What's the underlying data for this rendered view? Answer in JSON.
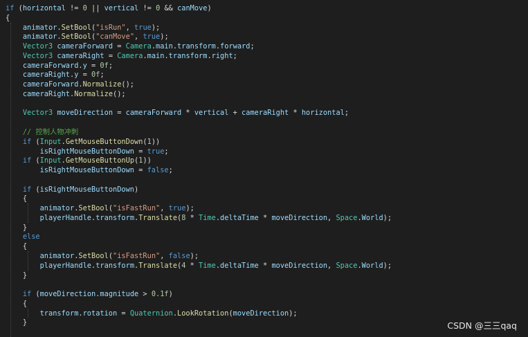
{
  "editor": {
    "colors": {
      "background": "#1e1e1e",
      "keyword": "#569cd6",
      "type": "#4ec9b0",
      "variable": "#9cdcfe",
      "method": "#dcdcaa",
      "string": "#d69d85",
      "number": "#b5cea8",
      "comment": "#57a64a",
      "plain": "#dcdcdc"
    },
    "lines": [
      {
        "indent": 0,
        "tokens": [
          [
            "kw",
            "if"
          ],
          [
            "pl",
            " ("
          ],
          [
            "var",
            "horizontal"
          ],
          [
            "pl",
            " != "
          ],
          [
            "num",
            "0"
          ],
          [
            "pl",
            " || "
          ],
          [
            "var",
            "vertical"
          ],
          [
            "pl",
            " != "
          ],
          [
            "num",
            "0"
          ],
          [
            "pl",
            " && "
          ],
          [
            "var",
            "canMove"
          ],
          [
            "pl",
            ")"
          ]
        ]
      },
      {
        "indent": 0,
        "tokens": [
          [
            "pl",
            "{"
          ]
        ]
      },
      {
        "indent": 1,
        "tokens": [
          [
            "var",
            "animator"
          ],
          [
            "pl",
            "."
          ],
          [
            "fn",
            "SetBool"
          ],
          [
            "pl",
            "("
          ],
          [
            "str",
            "\"isRun\""
          ],
          [
            "pl",
            ", "
          ],
          [
            "kw",
            "true"
          ],
          [
            "pl",
            ");"
          ]
        ]
      },
      {
        "indent": 1,
        "tokens": [
          [
            "var",
            "animator"
          ],
          [
            "pl",
            "."
          ],
          [
            "fn",
            "SetBool"
          ],
          [
            "pl",
            "("
          ],
          [
            "str",
            "\"canMove\""
          ],
          [
            "pl",
            ", "
          ],
          [
            "kw",
            "true"
          ],
          [
            "pl",
            ");"
          ]
        ]
      },
      {
        "indent": 1,
        "tokens": [
          [
            "ty",
            "Vector3"
          ],
          [
            "pl",
            " "
          ],
          [
            "var",
            "cameraForward"
          ],
          [
            "pl",
            " = "
          ],
          [
            "ty",
            "Camera"
          ],
          [
            "pl",
            "."
          ],
          [
            "var",
            "main"
          ],
          [
            "pl",
            "."
          ],
          [
            "var",
            "transform"
          ],
          [
            "pl",
            "."
          ],
          [
            "var",
            "forward"
          ],
          [
            "pl",
            ";"
          ]
        ]
      },
      {
        "indent": 1,
        "tokens": [
          [
            "ty",
            "Vector3"
          ],
          [
            "pl",
            " "
          ],
          [
            "var",
            "cameraRight"
          ],
          [
            "pl",
            " = "
          ],
          [
            "ty",
            "Camera"
          ],
          [
            "pl",
            "."
          ],
          [
            "var",
            "main"
          ],
          [
            "pl",
            "."
          ],
          [
            "var",
            "transform"
          ],
          [
            "pl",
            "."
          ],
          [
            "var",
            "right"
          ],
          [
            "pl",
            ";"
          ]
        ]
      },
      {
        "indent": 1,
        "tokens": [
          [
            "var",
            "cameraForward"
          ],
          [
            "pl",
            "."
          ],
          [
            "var",
            "y"
          ],
          [
            "pl",
            " = "
          ],
          [
            "num",
            "0f"
          ],
          [
            "pl",
            ";"
          ]
        ]
      },
      {
        "indent": 1,
        "tokens": [
          [
            "var",
            "cameraRight"
          ],
          [
            "pl",
            "."
          ],
          [
            "var",
            "y"
          ],
          [
            "pl",
            " = "
          ],
          [
            "num",
            "0f"
          ],
          [
            "pl",
            ";"
          ]
        ]
      },
      {
        "indent": 1,
        "tokens": [
          [
            "var",
            "cameraForward"
          ],
          [
            "pl",
            "."
          ],
          [
            "fn",
            "Normalize"
          ],
          [
            "pl",
            "();"
          ]
        ]
      },
      {
        "indent": 1,
        "tokens": [
          [
            "var",
            "cameraRight"
          ],
          [
            "pl",
            "."
          ],
          [
            "fn",
            "Normalize"
          ],
          [
            "pl",
            "();"
          ]
        ]
      },
      {
        "indent": 0,
        "tokens": []
      },
      {
        "indent": 1,
        "tokens": [
          [
            "ty",
            "Vector3"
          ],
          [
            "pl",
            " "
          ],
          [
            "var",
            "moveDirection"
          ],
          [
            "pl",
            " = "
          ],
          [
            "var",
            "cameraForward"
          ],
          [
            "pl",
            " * "
          ],
          [
            "var",
            "vertical"
          ],
          [
            "pl",
            " + "
          ],
          [
            "var",
            "cameraRight"
          ],
          [
            "pl",
            " * "
          ],
          [
            "var",
            "horizontal"
          ],
          [
            "pl",
            ";"
          ]
        ]
      },
      {
        "indent": 0,
        "tokens": []
      },
      {
        "indent": 1,
        "tokens": [
          [
            "cmt",
            "// 控制人物冲刺"
          ]
        ]
      },
      {
        "indent": 1,
        "tokens": [
          [
            "kw",
            "if"
          ],
          [
            "pl",
            " ("
          ],
          [
            "ty",
            "Input"
          ],
          [
            "pl",
            "."
          ],
          [
            "fn",
            "GetMouseButtonDown"
          ],
          [
            "pl",
            "("
          ],
          [
            "num",
            "1"
          ],
          [
            "pl",
            "))"
          ]
        ]
      },
      {
        "indent": 2,
        "tokens": [
          [
            "var",
            "isRightMouseButtonDown"
          ],
          [
            "pl",
            " = "
          ],
          [
            "kw",
            "true"
          ],
          [
            "pl",
            ";"
          ]
        ]
      },
      {
        "indent": 1,
        "tokens": [
          [
            "kw",
            "if"
          ],
          [
            "pl",
            " ("
          ],
          [
            "ty",
            "Input"
          ],
          [
            "pl",
            "."
          ],
          [
            "fn",
            "GetMouseButtonUp"
          ],
          [
            "pl",
            "("
          ],
          [
            "num",
            "1"
          ],
          [
            "pl",
            "))"
          ]
        ]
      },
      {
        "indent": 2,
        "tokens": [
          [
            "var",
            "isRightMouseButtonDown"
          ],
          [
            "pl",
            " = "
          ],
          [
            "kw",
            "false"
          ],
          [
            "pl",
            ";"
          ]
        ]
      },
      {
        "indent": 0,
        "tokens": []
      },
      {
        "indent": 1,
        "tokens": [
          [
            "kw",
            "if"
          ],
          [
            "pl",
            " ("
          ],
          [
            "var",
            "isRightMouseButtonDown"
          ],
          [
            "pl",
            ")"
          ]
        ]
      },
      {
        "indent": 1,
        "tokens": [
          [
            "pl",
            "{"
          ]
        ]
      },
      {
        "indent": 2,
        "tokens": [
          [
            "var",
            "animator"
          ],
          [
            "pl",
            "."
          ],
          [
            "fn",
            "SetBool"
          ],
          [
            "pl",
            "("
          ],
          [
            "str",
            "\"isFastRun\""
          ],
          [
            "pl",
            ", "
          ],
          [
            "kw",
            "true"
          ],
          [
            "pl",
            ");"
          ]
        ]
      },
      {
        "indent": 2,
        "tokens": [
          [
            "var",
            "playerHandle"
          ],
          [
            "pl",
            "."
          ],
          [
            "var",
            "transform"
          ],
          [
            "pl",
            "."
          ],
          [
            "fn",
            "Translate"
          ],
          [
            "pl",
            "("
          ],
          [
            "num",
            "8"
          ],
          [
            "pl",
            " * "
          ],
          [
            "ty",
            "Time"
          ],
          [
            "pl",
            "."
          ],
          [
            "var",
            "deltaTime"
          ],
          [
            "pl",
            " * "
          ],
          [
            "var",
            "moveDirection"
          ],
          [
            "pl",
            ", "
          ],
          [
            "ty",
            "Space"
          ],
          [
            "pl",
            "."
          ],
          [
            "var",
            "World"
          ],
          [
            "pl",
            ");"
          ]
        ]
      },
      {
        "indent": 1,
        "tokens": [
          [
            "pl",
            "}"
          ]
        ]
      },
      {
        "indent": 1,
        "tokens": [
          [
            "kw",
            "else"
          ]
        ]
      },
      {
        "indent": 1,
        "tokens": [
          [
            "pl",
            "{"
          ]
        ]
      },
      {
        "indent": 2,
        "tokens": [
          [
            "var",
            "animator"
          ],
          [
            "pl",
            "."
          ],
          [
            "fn",
            "SetBool"
          ],
          [
            "pl",
            "("
          ],
          [
            "str",
            "\"isFastRun\""
          ],
          [
            "pl",
            ", "
          ],
          [
            "kw",
            "false"
          ],
          [
            "pl",
            ");"
          ]
        ]
      },
      {
        "indent": 2,
        "tokens": [
          [
            "var",
            "playerHandle"
          ],
          [
            "pl",
            "."
          ],
          [
            "var",
            "transform"
          ],
          [
            "pl",
            "."
          ],
          [
            "fn",
            "Translate"
          ],
          [
            "pl",
            "("
          ],
          [
            "num",
            "4"
          ],
          [
            "pl",
            " * "
          ],
          [
            "ty",
            "Time"
          ],
          [
            "pl",
            "."
          ],
          [
            "var",
            "deltaTime"
          ],
          [
            "pl",
            " * "
          ],
          [
            "var",
            "moveDirection"
          ],
          [
            "pl",
            ", "
          ],
          [
            "ty",
            "Space"
          ],
          [
            "pl",
            "."
          ],
          [
            "var",
            "World"
          ],
          [
            "pl",
            ");"
          ]
        ]
      },
      {
        "indent": 1,
        "tokens": [
          [
            "pl",
            "}"
          ]
        ]
      },
      {
        "indent": 0,
        "tokens": []
      },
      {
        "indent": 1,
        "tokens": [
          [
            "kw",
            "if"
          ],
          [
            "pl",
            " ("
          ],
          [
            "var",
            "moveDirection"
          ],
          [
            "pl",
            "."
          ],
          [
            "var",
            "magnitude"
          ],
          [
            "pl",
            " > "
          ],
          [
            "num",
            "0.1f"
          ],
          [
            "pl",
            ")"
          ]
        ]
      },
      {
        "indent": 1,
        "tokens": [
          [
            "pl",
            "{"
          ]
        ]
      },
      {
        "indent": 2,
        "tokens": [
          [
            "var",
            "transform"
          ],
          [
            "pl",
            "."
          ],
          [
            "var",
            "rotation"
          ],
          [
            "pl",
            " = "
          ],
          [
            "ty",
            "Quaternion"
          ],
          [
            "pl",
            "."
          ],
          [
            "fn",
            "LookRotation"
          ],
          [
            "pl",
            "("
          ],
          [
            "var",
            "moveDirection"
          ],
          [
            "pl",
            ");"
          ]
        ]
      },
      {
        "indent": 1,
        "tokens": [
          [
            "pl",
            "}"
          ]
        ]
      }
    ]
  },
  "watermark": {
    "text": "CSDN @三三qaq"
  }
}
